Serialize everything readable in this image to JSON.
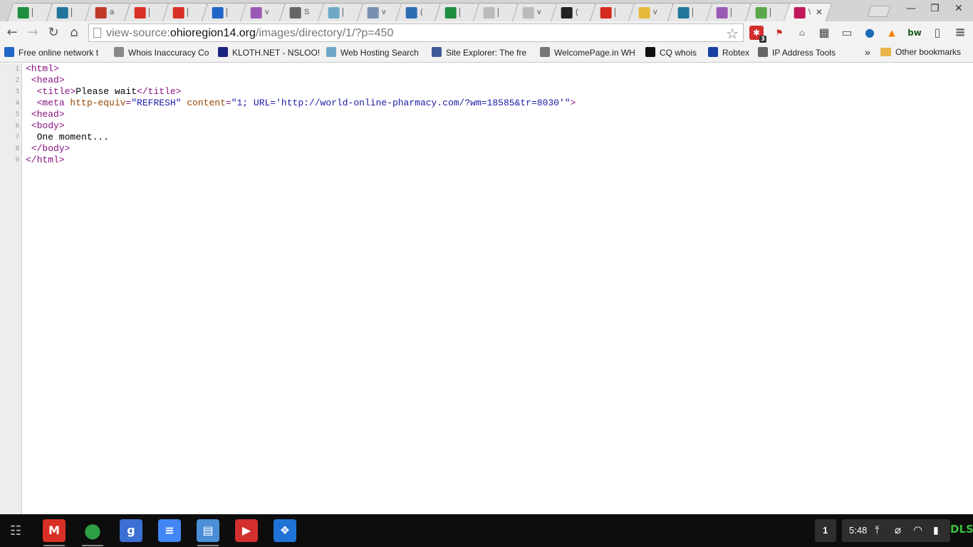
{
  "tabs": [
    {
      "icon": "sheets-icon",
      "title": "▏",
      "color": "#1e8e3e"
    },
    {
      "icon": "wordpress-icon",
      "title": "▏",
      "color": "#21759b"
    },
    {
      "icon": "shield-check-icon",
      "title": "a",
      "color": "#c0392b"
    },
    {
      "icon": "gmail-icon",
      "title": "▏",
      "color": "#d93025"
    },
    {
      "icon": "gmail-icon",
      "title": "▏",
      "color": "#d93025"
    },
    {
      "icon": "hostingh-icon",
      "title": "▏",
      "color": "#2166c8"
    },
    {
      "icon": "colorful-icon",
      "title": "v",
      "color": "#9b59b6"
    },
    {
      "icon": "wikipedia-icon",
      "title": "S",
      "color": "#666666"
    },
    {
      "icon": "shield-icon",
      "title": "▏",
      "color": "#6fa8c7"
    },
    {
      "icon": "calendar-icon",
      "title": "v",
      "color": "#7a8fb0"
    },
    {
      "icon": "globe-icon",
      "title": "(",
      "color": "#2f6db3"
    },
    {
      "icon": "sheets-icon",
      "title": "▏",
      "color": "#1e8e3e"
    },
    {
      "icon": "page-icon",
      "title": "▏",
      "color": "#bbbbbb"
    },
    {
      "icon": "page-icon",
      "title": "v",
      "color": "#bbbbbb"
    },
    {
      "icon": "script-f-icon",
      "title": "(",
      "color": "#222222"
    },
    {
      "icon": "canada-flag-icon",
      "title": "▏",
      "color": "#d52b1e"
    },
    {
      "icon": "pills-icon",
      "title": "v",
      "color": "#e8b93a"
    },
    {
      "icon": "wordpress-icon",
      "title": "▏",
      "color": "#21759b"
    },
    {
      "icon": "colorful-icon",
      "title": "▏",
      "color": "#9b59b6"
    },
    {
      "icon": "image-icon",
      "title": "▏",
      "color": "#5aa84b"
    },
    {
      "icon": "page-14-icon",
      "title": "\\",
      "color": "#c2185b",
      "active": true,
      "close": "✕"
    }
  ],
  "window_controls": {
    "minimize": "—",
    "restore": "❐",
    "close": "✕"
  },
  "nav": {
    "back": "←",
    "forward": "→",
    "reload": "↻",
    "home": "⌂"
  },
  "url": {
    "scheme": "view-source:",
    "host": "ohioregion14.org",
    "path": "/images/directory/1/?p=450",
    "star": "☆"
  },
  "extensions": [
    {
      "icon": "lastpass-icon",
      "badge": "3",
      "color": "#d32f2f"
    },
    {
      "icon": "flag-icon",
      "color": "#c62828"
    },
    {
      "icon": "ghostery-icon",
      "color": "#9e9e9e"
    },
    {
      "icon": "film-icon",
      "color": "#444444"
    },
    {
      "icon": "cast-icon",
      "color": "#555555"
    },
    {
      "icon": "globe-icon",
      "color": "#1e6bb8"
    },
    {
      "icon": "firefox-icon",
      "color": "#f57c00"
    },
    {
      "icon": "bw-icon",
      "label": "bw",
      "color": "#1b5e20"
    },
    {
      "icon": "sidebar-icon",
      "color": "#555555"
    },
    {
      "icon": "menu-icon",
      "color": "#555555"
    }
  ],
  "bookmarks": [
    {
      "icon": "hostingh-icon",
      "label": "Free online network t",
      "color": "#2166c8"
    },
    {
      "icon": "whois-icon",
      "label": "Whois Inaccuracy Co",
      "color": "#888888"
    },
    {
      "icon": "kloth-icon",
      "label": "KLOTH.NET - NSLOO!",
      "color": "#1a237e"
    },
    {
      "icon": "shield-icon",
      "label": "Web Hosting Search",
      "color": "#6fa8c7"
    },
    {
      "icon": "dollar-icon",
      "label": "Site Explorer: The fre",
      "color": "#3d5a98"
    },
    {
      "icon": "gear-icon",
      "label": "WelcomePage.in WH",
      "color": "#777777"
    },
    {
      "icon": "cq-icon",
      "label": "CQ whois",
      "color": "#111111"
    },
    {
      "icon": "robtex-icon",
      "label": "Robtex",
      "color": "#1a3fa3"
    },
    {
      "icon": "network-icon",
      "label": "IP Address Tools",
      "color": "#666666"
    }
  ],
  "bookmarks_overflow": "»",
  "other_bookmarks": {
    "icon": "folder-icon",
    "label": "Other bookmarks"
  },
  "source": {
    "line_numbers": [
      "1",
      "2",
      "3",
      "4",
      "5",
      "6",
      "7",
      "8",
      "9"
    ],
    "lines": [
      [
        {
          "t": "tag",
          "v": "<html>"
        }
      ],
      [
        {
          "t": "txt",
          "v": " "
        },
        {
          "t": "tag",
          "v": "<head>"
        }
      ],
      [
        {
          "t": "txt",
          "v": "  "
        },
        {
          "t": "tag",
          "v": "<title>"
        },
        {
          "t": "txt",
          "v": "Please wait"
        },
        {
          "t": "tag",
          "v": "</title>"
        }
      ],
      [
        {
          "t": "txt",
          "v": "  "
        },
        {
          "t": "tag",
          "v": "<meta "
        },
        {
          "t": "attr",
          "v": "http-equiv"
        },
        {
          "t": "tag",
          "v": "="
        },
        {
          "t": "val",
          "v": "\"REFRESH\""
        },
        {
          "t": "txt",
          "v": " "
        },
        {
          "t": "attr",
          "v": "content"
        },
        {
          "t": "tag",
          "v": "="
        },
        {
          "t": "val",
          "v": "\"1; URL='http://world-online-pharmacy.com/?wm=18585&tr=8030'\""
        },
        {
          "t": "tag",
          "v": ">"
        }
      ],
      [
        {
          "t": "txt",
          "v": " "
        },
        {
          "t": "tag",
          "v": "<head>"
        }
      ],
      [
        {
          "t": "txt",
          "v": " "
        },
        {
          "t": "tag",
          "v": "<body>"
        }
      ],
      [
        {
          "t": "txt",
          "v": "  One moment..."
        }
      ],
      [
        {
          "t": "txt",
          "v": " "
        },
        {
          "t": "tag",
          "v": "</body>"
        }
      ],
      [
        {
          "t": "tag",
          "v": "</html>"
        }
      ]
    ]
  },
  "shelf": {
    "launcher_icon": "☷",
    "apps": [
      {
        "icon": "gmail-icon",
        "glyph": "M",
        "color": "#d93025",
        "running": true
      },
      {
        "icon": "chrome-icon",
        "glyph": "●",
        "color": "#2e9e44",
        "running": true
      },
      {
        "icon": "google-search-icon",
        "glyph": "g",
        "color": "#3b6fd4"
      },
      {
        "icon": "docs-icon",
        "glyph": "≡",
        "color": "#4285f4"
      },
      {
        "icon": "files-icon",
        "glyph": "▤",
        "color": "#4a8fd8",
        "running": true
      },
      {
        "icon": "youtube-icon",
        "glyph": "▶",
        "color": "#d32f2f"
      },
      {
        "icon": "dropbox-icon",
        "glyph": "❖",
        "color": "#1f73d6"
      }
    ],
    "user_number": "1",
    "clock": "5:48",
    "dls_label": "DLS"
  }
}
